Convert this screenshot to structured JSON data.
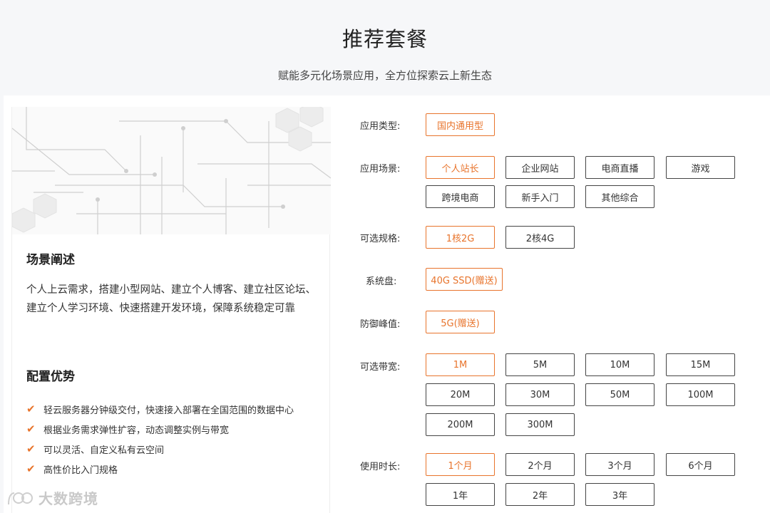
{
  "header": {
    "title": "推荐套餐",
    "subtitle": "赋能多元化场景应用，全方位探索云上新生态"
  },
  "scenario": {
    "title": "场景阐述",
    "description": "个人上云需求，搭建小型网站、建立个人博客、建立社区论坛、建立个人学习环境、快速搭建开发环境，保障系统稳定可靠"
  },
  "advantages": {
    "title": "配置优势",
    "items": [
      "轻云服务器分钟级交付，快速接入部署在全国范围的数据中心",
      "根据业务需求弹性扩容，动态调整实例与带宽",
      "可以灵活、自定义私有云空间",
      "高性价比入门规格"
    ]
  },
  "config": {
    "app_type": {
      "label": "应用类型:",
      "options": [
        "国内通用型"
      ],
      "selected": "国内通用型"
    },
    "scene": {
      "label": "应用场景:",
      "options": [
        "个人站长",
        "企业网站",
        "电商直播",
        "游戏",
        "跨境电商",
        "新手入门",
        "其他综合"
      ],
      "selected": "个人站长"
    },
    "spec": {
      "label": "可选规格:",
      "options": [
        "1核2G",
        "2核4G"
      ],
      "selected": "1核2G"
    },
    "disk": {
      "label": "系统盘:",
      "options": [
        "40G SSD(赠送)"
      ],
      "selected": "40G SSD(赠送)"
    },
    "defense": {
      "label": "防御峰值:",
      "options": [
        "5G(赠送)"
      ],
      "selected": "5G(赠送)"
    },
    "bandwidth": {
      "label": "可选带宽:",
      "options": [
        "1M",
        "5M",
        "10M",
        "15M",
        "20M",
        "30M",
        "50M",
        "100M",
        "200M",
        "300M"
      ],
      "selected": "1M"
    },
    "duration": {
      "label": "使用时长:",
      "options": [
        "1个月",
        "2个月",
        "3个月",
        "6个月",
        "1年",
        "2年",
        "3年"
      ],
      "selected": "1个月"
    }
  },
  "watermark": {
    "text": "大数跨境"
  },
  "colors": {
    "accent": "#e8742c",
    "page_bg": "#f6f7f9"
  }
}
